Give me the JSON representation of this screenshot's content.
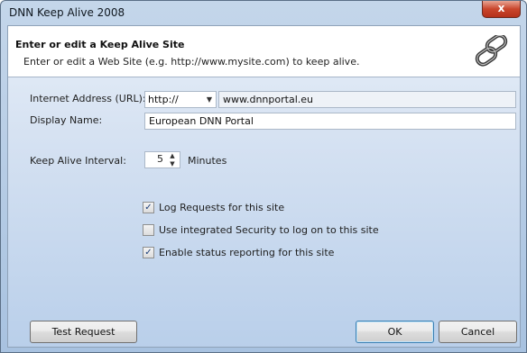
{
  "window": {
    "title": "DNN Keep Alive 2008",
    "close_glyph": "x"
  },
  "header": {
    "title": "Enter or edit a Keep Alive Site",
    "description": "Enter or edit a Web Site (e.g. http://www.mysite.com) to keep alive.",
    "icon": "chain-link-icon"
  },
  "form": {
    "url_label": "Internet Address (URL):",
    "protocol_value": "http://",
    "url_value": "www.dnnportal.eu",
    "display_name_label": "Display Name:",
    "display_name_value": "European DNN Portal",
    "interval_label": "Keep Alive Interval:",
    "interval_value": "5",
    "interval_unit": "Minutes"
  },
  "checkboxes": [
    {
      "label": "Log Requests for this site",
      "checked": true
    },
    {
      "label": "Use integrated Security to log on to this site",
      "checked": false
    },
    {
      "label": "Enable status reporting for this site",
      "checked": true
    }
  ],
  "buttons": {
    "test": "Test Request",
    "ok": "OK",
    "cancel": "Cancel"
  },
  "glyphs": {
    "check": "✓",
    "dropdown": "▼",
    "spin_up": "▲",
    "spin_down": "▼"
  }
}
